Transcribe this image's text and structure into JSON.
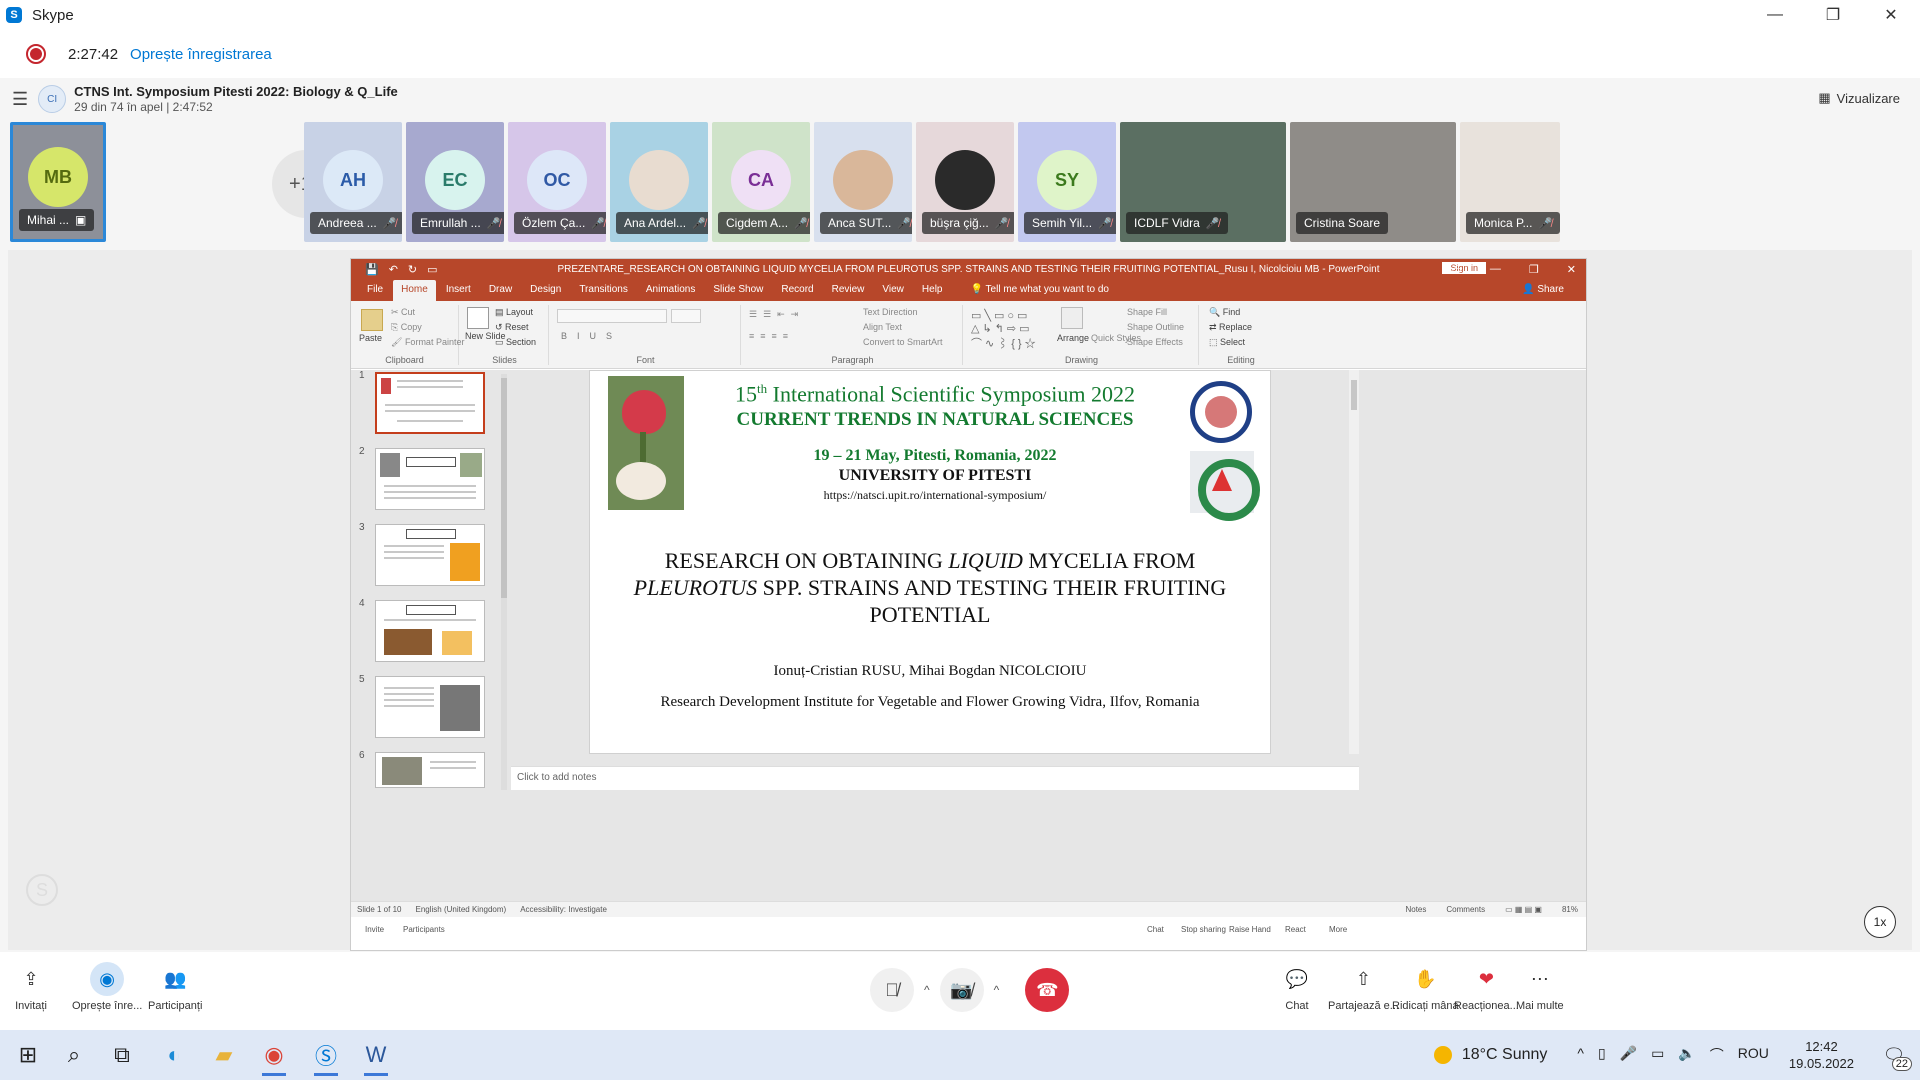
{
  "window": {
    "title": "Skype",
    "minimize": "—",
    "maximize": "❐",
    "close": "✕"
  },
  "recording": {
    "time": "2:27:42",
    "stop_label": "Oprește înregistrarea"
  },
  "conversation": {
    "avatar": "CI",
    "name": "CTNS Int. Symposium Pitesti 2022: Biology & Q_Life",
    "subtitle": "29 din 74 în apel | 2:47:52",
    "view_label": "Vizualizare"
  },
  "participants": {
    "self": {
      "initials": "MB",
      "name": "Mihai ...",
      "color": "#d6e66a"
    },
    "more_count": "+17",
    "tiles": [
      {
        "initials": "AH",
        "name": "Andreea ...",
        "bg": "#c8d2e6",
        "avatar_bg": "#dce9f7",
        "avatar_fg": "#2b5ba8"
      },
      {
        "initials": "EC",
        "name": "Emrullah ...",
        "bg": "#a7a9cf",
        "avatar_bg": "#d8f3ee",
        "avatar_fg": "#2a7b6a"
      },
      {
        "initials": "OC",
        "name": "Özlem Ça...",
        "bg": "#d6c6e9",
        "avatar_bg": "#dde7f8",
        "avatar_fg": "#3059a5"
      },
      {
        "initials": "",
        "name": "Ana Ardel...",
        "bg": "#a9d2e4",
        "avatar_bg": "#e8dcd0",
        "avatar_fg": "#444"
      },
      {
        "initials": "CA",
        "name": "Cigdem A...",
        "bg": "#cfe3c9",
        "avatar_bg": "#efe0f5",
        "avatar_fg": "#7a2f96"
      },
      {
        "initials": "",
        "name": "Anca SUT...",
        "bg": "#d8e0ee",
        "avatar_bg": "#d9b79a",
        "avatar_fg": "#444"
      },
      {
        "initials": "",
        "name": "büşra çiğ...",
        "bg": "#e6d8da",
        "avatar_bg": "#2a2a2a",
        "avatar_fg": "#eee"
      },
      {
        "initials": "SY",
        "name": "Semih Yil...",
        "bg": "#c2c8ef",
        "avatar_bg": "#dff4c9",
        "avatar_fg": "#3c7a1d"
      }
    ],
    "video_tiles": [
      {
        "name": "ICDLF Vidra",
        "bg": "#5b6f62"
      },
      {
        "name": "Cristina Soare",
        "bg": "#8f8c88"
      },
      {
        "name": "Monica P...",
        "bg": "#e8e2dc"
      }
    ]
  },
  "powerpoint": {
    "title": "PREZENTARE_RESEARCH ON OBTAINING LIQUID MYCELIA FROM PLEUROTUS SPP. STRAINS AND TESTING THEIR FRUITING POTENTIAL_Rusu I, Nicolcioiu MB  -  PowerPoint",
    "signin": "Sign in",
    "tabs": [
      "File",
      "Home",
      "Insert",
      "Draw",
      "Design",
      "Transitions",
      "Animations",
      "Slide Show",
      "Record",
      "Review",
      "View",
      "Help"
    ],
    "tell_me": "Tell me what you want to do",
    "share": "Share",
    "ribbon": {
      "clipboard": {
        "label": "Clipboard",
        "paste": "Paste",
        "cut": "Cut",
        "copy": "Copy",
        "format_painter": "Format Painter"
      },
      "slides": {
        "label": "Slides",
        "new_slide": "New Slide",
        "layout": "Layout",
        "reset": "Reset",
        "section": "Section"
      },
      "font": {
        "label": "Font"
      },
      "paragraph": {
        "label": "Paragraph",
        "text_direction": "Text Direction",
        "align_text": "Align Text",
        "convert": "Convert to SmartArt"
      },
      "drawing": {
        "label": "Drawing",
        "arrange": "Arrange",
        "quick_styles": "Quick Styles",
        "shape_fill": "Shape Fill",
        "shape_outline": "Shape Outline",
        "shape_effects": "Shape Effects"
      },
      "editing": {
        "label": "Editing",
        "find": "Find",
        "replace": "Replace",
        "select": "Select"
      }
    },
    "thumbnails": [
      "1",
      "2",
      "3",
      "4",
      "5",
      "6"
    ],
    "slide": {
      "symposium_line1": "15",
      "symposium_sup": "th",
      "symposium_rest": " International Scientific Symposium 2022",
      "symposium_line2": "CURRENT TRENDS IN NATURAL SCIENCES",
      "dates": "19 – 21 May, Pitesti, Romania, 2022",
      "university": "UNIVERSITY OF PITESTI",
      "url": "https://natsci.upit.ro/international-symposium/",
      "title_part1": "RESEARCH ON OBTAINING ",
      "title_italic1": "LIQUID",
      "title_part2": " MYCELIA FROM ",
      "title_italic2": "PLEUROTUS",
      "title_part3": " SPP. STRAINS AND TESTING THEIR FRUITING POTENTIAL",
      "authors": "Ionuț-Cristian RUSU, Mihai Bogdan NICOLCIOIU",
      "affiliation": "Research Development Institute for Vegetable and Flower Growing Vidra, Ilfov, Romania"
    },
    "notes_placeholder": "Click to add notes",
    "status": {
      "slide_count": "Slide 1 of 10",
      "language": "English (United Kingdom)",
      "accessibility": "Accessibility: Investigate",
      "notes": "Notes",
      "comments": "Comments",
      "zoom": "81%"
    },
    "remote_bar": {
      "invite": "Invite",
      "participants": "Participants",
      "chat": "Chat",
      "stop_sharing": "Stop sharing",
      "raise_hand": "Raise Hand",
      "react": "React",
      "more": "More"
    }
  },
  "speed": "1x",
  "controls": {
    "invite": "Invitați",
    "stop_recording": "Oprește înre...",
    "participants": "Participanți",
    "chat": "Chat",
    "share_screen": "Partajează e...",
    "raise_hand": "Ridicați mâna",
    "react": "Reacționea...",
    "more": "Mai multe"
  },
  "taskbar": {
    "temperature": "18°C",
    "weather": "Sunny",
    "language": "ROU",
    "time": "12:42",
    "date": "19.05.2022",
    "notifications": "22"
  }
}
